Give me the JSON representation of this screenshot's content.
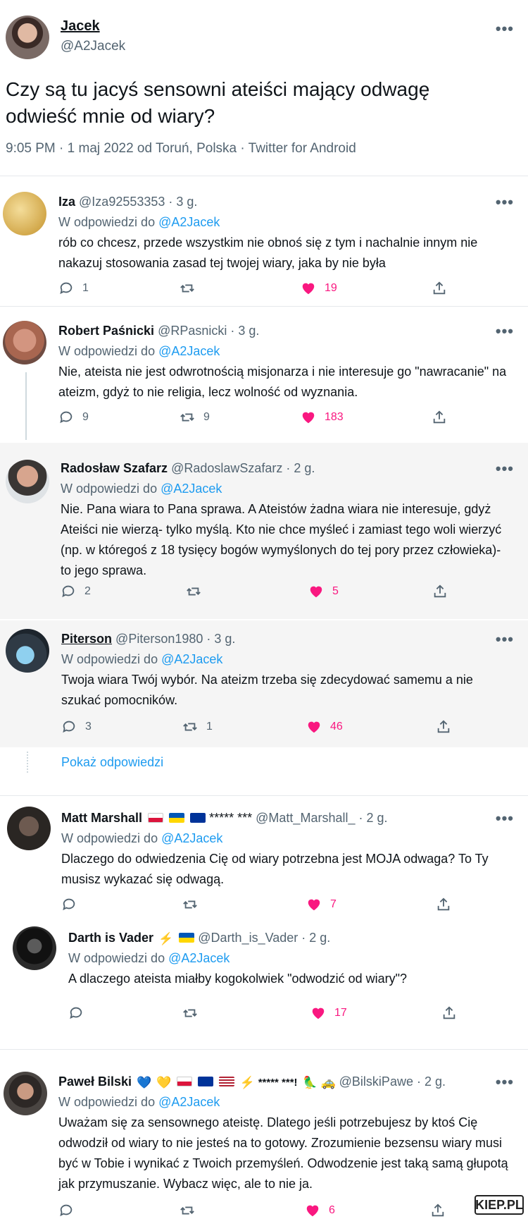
{
  "main": {
    "name": "Jacek",
    "handle": "@A2Jacek",
    "text": "Czy są tu jacyś sensowni ateiści mający odwagę odwieść mnie od wiary?",
    "meta": "9:05 PM · 1 maj 2022 od Toruń, Polska · Twitter for Android"
  },
  "in_reply_prefix": "W odpowiedzi do",
  "in_reply_mention": "@A2Jacek",
  "more_glyph": "•••",
  "show_replies": "Pokaż odpowiedzi",
  "watermark": "KIEP.PL",
  "replies": [
    {
      "name": "Iza",
      "handle": "@Iza92553353 · 3 g.",
      "text": "rób co chcesz, przede wszystkim nie obnoś się z tym i nachalnie innym nie nakazuj stosowania zasad tej twojej wiary, jaka by nie była",
      "replies": "1",
      "retweets": "",
      "likes": "19",
      "avatar_color": "#e7c36d"
    },
    {
      "name": "Robert Paśnicki",
      "handle": "@RPasnicki · 3 g.",
      "text": "Nie, ateista nie jest odwrotnością misjonarza i nie interesuje go \"nawracanie\" na ateizm, gdyż to nie religia, lecz wolność od wyznania.",
      "replies": "9",
      "retweets": "9",
      "likes": "183",
      "avatar_color": "#b36a52"
    },
    {
      "name": "Radosław Szafarz",
      "handle": "@RadoslawSzafarz · 2 g.",
      "text": "Nie. Pana wiara to Pana sprawa. A Ateistów żadna wiara nie interesuje, gdyż Ateiści nie wierzą- tylko myślą. Kto nie chce myśleć i zamiast tego woli wierzyć (np. w któregoś z 18 tysięcy bogów wymyślonych do tej pory przez człowieka)- to jego sprawa.",
      "replies": "2",
      "retweets": "",
      "likes": "5",
      "avatar_color": "#6d7b8a"
    },
    {
      "name": "Piterson",
      "handle": "@Piterson1980 · 3 g.",
      "text": "Twoja wiara Twój wybór. Na ateizm trzeba się zdecydować samemu a nie szukać pomocników.",
      "replies": "3",
      "retweets": "1",
      "likes": "46",
      "avatar_color": "#3f4a57"
    },
    {
      "name": "Matt Marshall",
      "flags": [
        "pl",
        "ua",
        "eu"
      ],
      "extra": "***** ***",
      "handle": "@Matt_Marshall_ · 2 g.",
      "text": "Dlaczego do odwiedzenia Cię od wiary potrzebna jest MOJA odwaga? To Ty musisz wykazać się odwagą.",
      "replies": "",
      "retweets": "",
      "likes": "7",
      "avatar_color": "#2d2a27"
    },
    {
      "name": "Darth is Vader",
      "flags": [
        "ua"
      ],
      "emoji_before": "⚡",
      "handle": "@Darth_is_Vader · 2 g.",
      "text": "A dlaczego ateista miałby kogokolwiek \"odwodzić od wiary\"?",
      "replies": "",
      "retweets": "",
      "likes": "17",
      "avatar_color": "#1a1a1a"
    },
    {
      "name": "Paweł Bilski",
      "hearts": [
        "💙",
        "💛"
      ],
      "flags": [
        "pl",
        "eu",
        "us"
      ],
      "emoji_mid": "⚡",
      "extra": "***** ***!",
      "emoji_after": "🦜 🚕",
      "handle": "@BilskiPawe · 2 g.",
      "text": "Uważam się za sensownego ateistę. Dlatego jeśli potrzebujesz by ktoś Cię odwodził od wiary to nie jesteś na to gotowy. Zrozumienie bezsensu wiary musi być w Tobie i wynikać z Twoich przemyśleń. Odwodzenie jest taką samą głupotą jak przymuszanie. Wybacz więc, ale to nie ja.",
      "replies": "",
      "retweets": "",
      "likes": "6",
      "avatar_color": "#3b3430"
    }
  ]
}
